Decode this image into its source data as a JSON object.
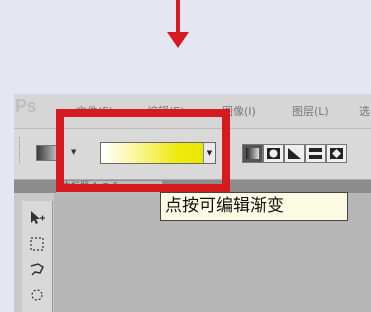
{
  "app": {
    "logo": "Ps",
    "menu": [
      {
        "label": "文件(F)"
      },
      {
        "label": "编辑(E)"
      },
      {
        "label": "图像(I)"
      },
      {
        "label": "图层(L)"
      },
      {
        "label": "选"
      }
    ]
  },
  "options_bar": {
    "gradient_colors": [
      "#ffffff",
      "#e8e600"
    ],
    "gradient_types": [
      "linear",
      "radial",
      "angle",
      "reflected",
      "diamond"
    ],
    "active_gradient_type": "linear"
  },
  "document_tab": {
    "label": "未标题-1 @ 5"
  },
  "tools": [
    "move-tool",
    "marquee-tool",
    "lasso-tool",
    "quick-selection-tool"
  ],
  "annotation": {
    "tooltip": "点按可编辑渐变",
    "highlight_color": "#d61a1f",
    "arrow_color": "#d61a1f"
  }
}
